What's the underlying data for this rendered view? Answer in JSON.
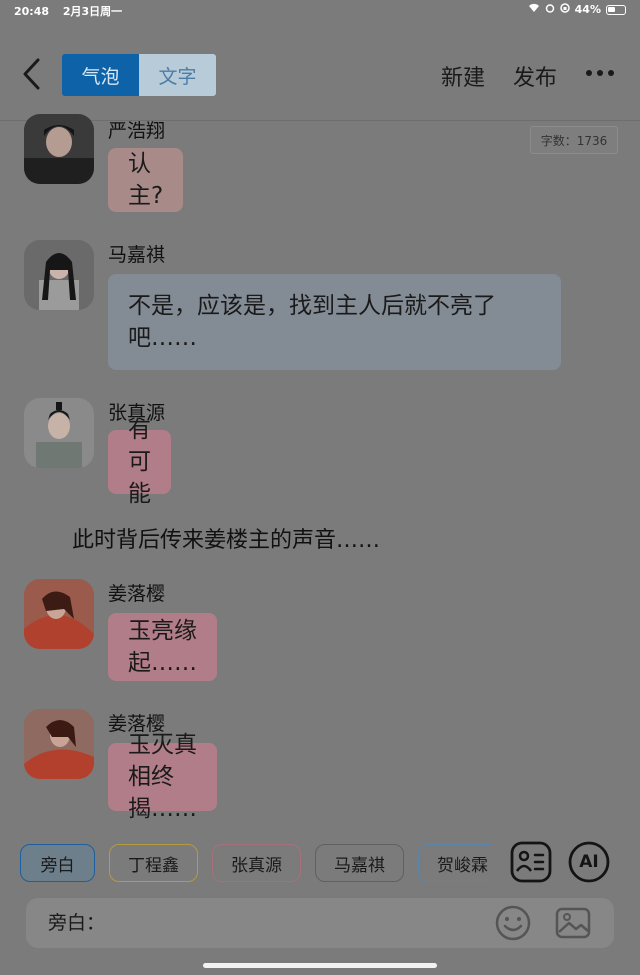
{
  "status_bar": {
    "time": "20:48",
    "date": "2月3日周一",
    "battery": "44%"
  },
  "top_bar": {
    "tabs": [
      {
        "label": "气泡",
        "active": true
      },
      {
        "label": "文字",
        "active": false
      }
    ],
    "new_label": "新建",
    "publish_label": "发布"
  },
  "word_count": "字数：1736",
  "messages": [
    {
      "sender": "严浩翔",
      "text": "认主?"
    },
    {
      "sender": "马嘉祺",
      "text_line1": "不是，应该是，找到主人后就不亮了",
      "text_line2": "吧……"
    },
    {
      "sender": "张真源",
      "text": "有可能"
    },
    {
      "narration": "此时背后传来姜楼主的声音……"
    },
    {
      "sender": "姜落樱",
      "text": "玉亮缘起……"
    },
    {
      "sender": "姜落樱",
      "text": "玉灭真相终揭……"
    }
  ],
  "chips": [
    "旁白",
    "丁程鑫",
    "张真源",
    "马嘉祺",
    "贺峻霖"
  ],
  "ai_label": "AI",
  "input": {
    "label": "旁白："
  },
  "colors": {
    "accent": "#0e62a8",
    "pink_bubble": "#b17d89",
    "grey_bubble": "#838b95"
  }
}
